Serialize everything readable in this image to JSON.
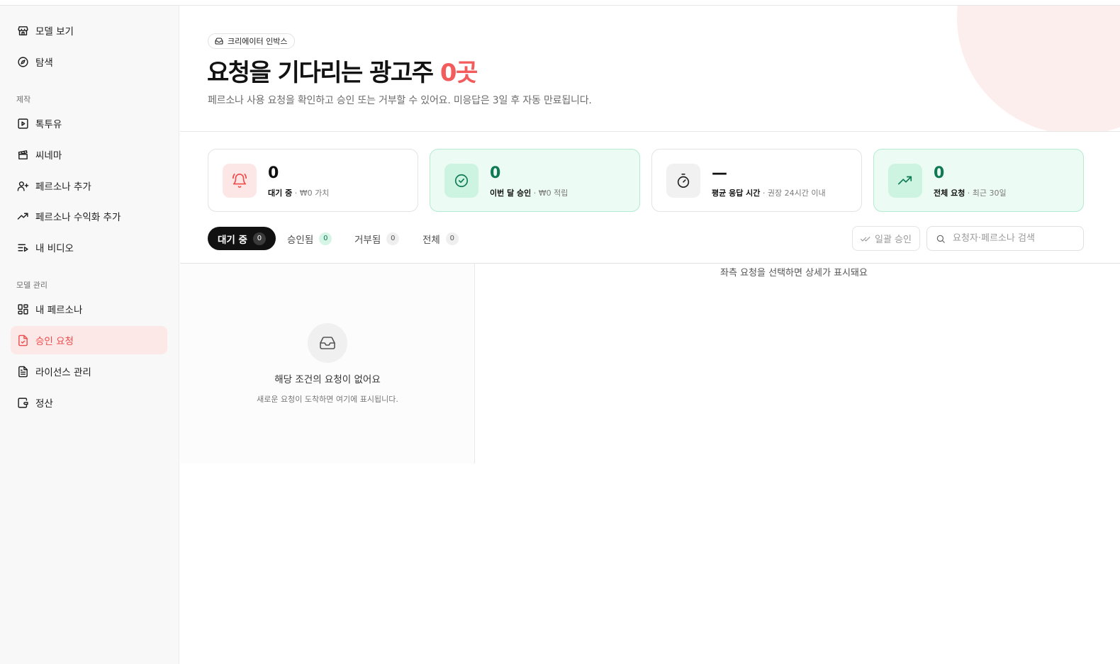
{
  "sidebar": {
    "top_items": [
      {
        "label": "모델 보기",
        "icon": "store-icon"
      },
      {
        "label": "탐색",
        "icon": "compass-icon"
      }
    ],
    "sections": [
      {
        "label": "제작",
        "items": [
          {
            "label": "톡투유",
            "icon": "play-square-icon"
          },
          {
            "label": "씨네마",
            "icon": "clapperboard-icon"
          },
          {
            "label": "페르소나 추가",
            "icon": "user-plus-icon"
          },
          {
            "label": "페르소나 수익화 추가",
            "icon": "trending-up-icon"
          },
          {
            "label": "내 비디오",
            "icon": "list-video-icon"
          }
        ]
      },
      {
        "label": "모델 관리",
        "items": [
          {
            "label": "내 페르소나",
            "icon": "layout-grid-icon"
          },
          {
            "label": "승인 요청",
            "icon": "file-check-icon",
            "active": true
          },
          {
            "label": "라이선스 관리",
            "icon": "file-text-icon"
          },
          {
            "label": "정산",
            "icon": "wallet-icon"
          }
        ]
      }
    ]
  },
  "header": {
    "badge": "크리에이터 인박스",
    "title_main": "요청을 기다리는 광고주 ",
    "title_count": "0곳",
    "subtitle": "페르소나 사용 요청을 확인하고 승인 또는 거부할 수 있어요. 미응답은 3일 후 자동 만료됩니다."
  },
  "stats": [
    {
      "value": "0",
      "label": "대기 중",
      "note": " · ₩0 가치",
      "icon": "bell-icon",
      "theme": "red"
    },
    {
      "value": "0",
      "label": "이번 달 승인",
      "note": " · ₩0 적립",
      "icon": "check-circle-icon",
      "theme": "green"
    },
    {
      "value": "—",
      "label": "평균 응답 시간",
      "note": " · 권장 24시간 이내",
      "icon": "timer-icon",
      "theme": "gray"
    },
    {
      "value": "0",
      "label": "전체 요청",
      "note": " · 최근 30일",
      "icon": "trending-up-icon",
      "theme": "green"
    }
  ],
  "tabs": [
    {
      "label": "대기 중",
      "count": "0",
      "active": true
    },
    {
      "label": "승인됨",
      "count": "0"
    },
    {
      "label": "거부됨",
      "count": "0"
    },
    {
      "label": "전체",
      "count": "0"
    }
  ],
  "toolbar": {
    "bulk_approve": "일괄 승인",
    "search_placeholder": "요청자·페르소나 검색"
  },
  "list": {
    "empty_title": "해당 조건의 요청이 없어요",
    "empty_desc": "새로운 요청이 도착하면 여기에 표시됩니다."
  },
  "detail": {
    "hint": "좌측 요청을 선택하면 상세가 표시돼요"
  },
  "colors": {
    "accent": "#f25c5c",
    "active_bg": "#fde8e8",
    "green": "#0d7a55",
    "green_bg": "#ecfbf3"
  }
}
